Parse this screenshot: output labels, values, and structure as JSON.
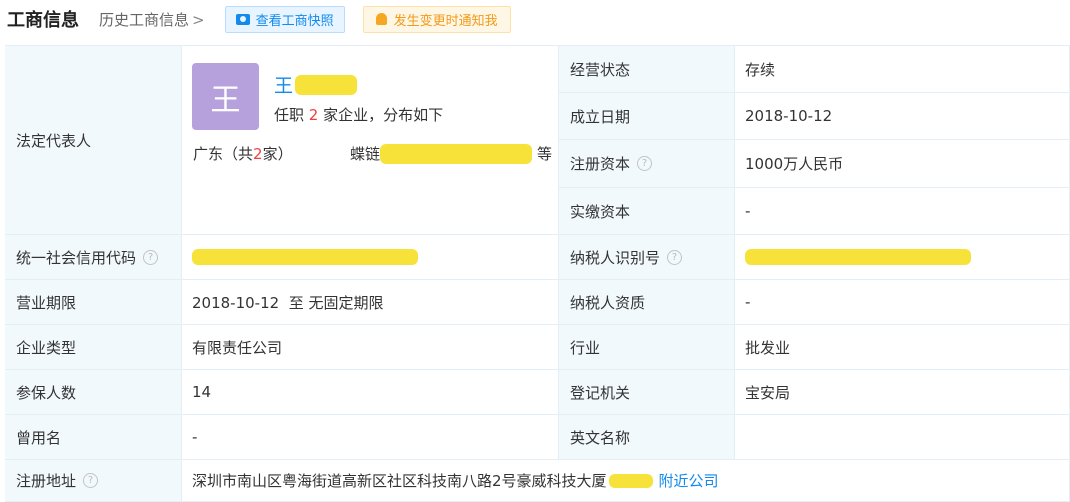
{
  "header": {
    "title": "工商信息",
    "history_link": "历史工商信息",
    "history_chevron": ">",
    "snapshot_button": "查看工商快照",
    "notify_button": "发生变更时通知我"
  },
  "colors": {
    "accent_blue": "#128bed",
    "label_bg": "#f2f9fc",
    "border": "#e4eef6",
    "notify_orange": "#f39a1a",
    "avatar_purple": "#b6a1dc",
    "highlight_red": "#f04040"
  },
  "legal_rep": {
    "label": "法定代表人",
    "avatar_char": "王",
    "surname": "王",
    "sub_prefix": "任职",
    "sub_count": "2",
    "sub_suffix": "家企业，分布如下",
    "region_prefix": "广东（共",
    "region_count": "2",
    "region_suffix": "家）",
    "company_prefix": "蝶链",
    "etc": "等"
  },
  "left_rows": [
    {
      "label": "统一社会信用代码",
      "value": "",
      "has_help": true,
      "redacted": true
    },
    {
      "label": "营业期限",
      "value": "2018-10-12  至 无固定期限",
      "has_help": false
    },
    {
      "label": "企业类型",
      "value": "有限责任公司",
      "has_help": false
    },
    {
      "label": "参保人数",
      "value": "14",
      "has_help": false
    },
    {
      "label": "曾用名",
      "value": "-",
      "has_help": false
    }
  ],
  "right_rows": [
    {
      "label": "经营状态",
      "value": "存续",
      "has_help": false
    },
    {
      "label": "成立日期",
      "value": "2018-10-12",
      "has_help": false
    },
    {
      "label": "注册资本",
      "value": "1000万人民币",
      "has_help": true
    },
    {
      "label": "实缴资本",
      "value": "-",
      "has_help": false
    },
    {
      "label": "纳税人识别号",
      "value": "",
      "has_help": true,
      "redacted": true
    },
    {
      "label": "纳税人资质",
      "value": "-",
      "has_help": false
    },
    {
      "label": "行业",
      "value": "批发业",
      "has_help": false
    },
    {
      "label": "登记机关",
      "value": "宝安局",
      "has_help": false
    },
    {
      "label": "英文名称",
      "value": "",
      "has_help": false
    }
  ],
  "address": {
    "label": "注册地址",
    "value": "深圳市南山区粤海街道高新区社区科技南八路2号豪威科技大厦",
    "nearby_link": "附近公司"
  },
  "help_glyph": "?"
}
